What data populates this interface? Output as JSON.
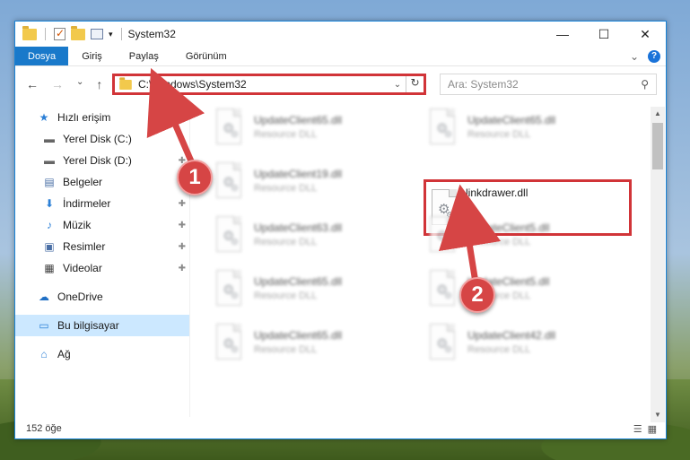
{
  "window": {
    "title": "System32",
    "controls": {
      "minimize": "—",
      "maximize": "☐",
      "close": "✕"
    }
  },
  "ribbon": {
    "tabs": [
      "Dosya",
      "Giriş",
      "Paylaş",
      "Görünüm"
    ],
    "expand": "⌄",
    "help": "?"
  },
  "nav_buttons": {
    "back": "←",
    "forward": "→",
    "recent": "⌄",
    "up": "↑"
  },
  "address": {
    "path": "C:\\Windows\\System32",
    "dropdown": "⌄",
    "refresh": "↻"
  },
  "search": {
    "placeholder": "Ara: System32",
    "icon": "⚲"
  },
  "sidebar": {
    "items": [
      {
        "label": "Hızlı erişim",
        "icon": "★"
      },
      {
        "label": "Yerel Disk (C:)",
        "icon": "▬"
      },
      {
        "label": "Yerel Disk (D:)",
        "icon": "▬"
      },
      {
        "label": "Belgeler",
        "icon": "▤"
      },
      {
        "label": "İndirmeler",
        "icon": "⬇"
      },
      {
        "label": "Müzik",
        "icon": "♪"
      },
      {
        "label": "Resimler",
        "icon": "▣"
      },
      {
        "label": "Videolar",
        "icon": "▦"
      },
      {
        "label": "OneDrive",
        "icon": "☁"
      },
      {
        "label": "Bu bilgisayar",
        "icon": "▭"
      },
      {
        "label": "Ağ",
        "icon": "⌂"
      }
    ],
    "pin": "📌"
  },
  "files": {
    "left": [
      {
        "name": "UpdateClient65.dll",
        "type": "Resource DLL"
      },
      {
        "name": "UpdateClient19.dll",
        "type": "Resource DLL"
      },
      {
        "name": "UpdateClient63.dll",
        "type": "Resource DLL"
      },
      {
        "name": "UpdateClient65.dll",
        "type": "Resource DLL"
      },
      {
        "name": "UpdateClient65.dll",
        "type": "Resource DLL"
      }
    ],
    "right": [
      {
        "name": "UpdateClient65.dll",
        "type": "Resource DLL"
      },
      {
        "name": "linkdrawer.dll",
        "type": ""
      },
      {
        "name": "UpdateClient5.dll",
        "type": "Resource DLL"
      },
      {
        "name": "UpdateClient5.dll",
        "type": "Resource DLL"
      },
      {
        "name": "UpdateClient42.dll",
        "type": "Resource DLL"
      }
    ]
  },
  "status": {
    "count": "152 öğe"
  },
  "callouts": {
    "one": "1",
    "two": "2"
  },
  "colors": {
    "highlight": "#d13438",
    "callout": "#d64545",
    "accent": "#1979ca"
  }
}
